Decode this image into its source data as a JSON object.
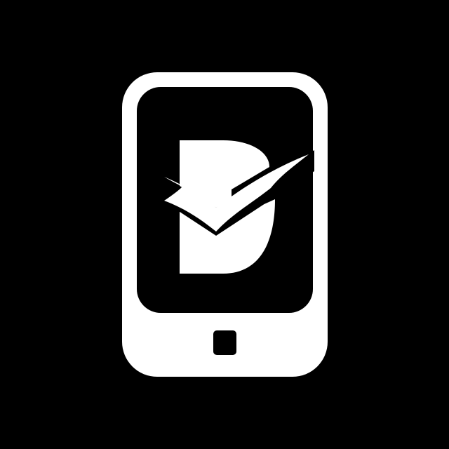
{
  "app_icon": {
    "icon": "phone-d-checkmark-logo",
    "colors": {
      "background": "#000000",
      "foreground": "#ffffff"
    }
  }
}
